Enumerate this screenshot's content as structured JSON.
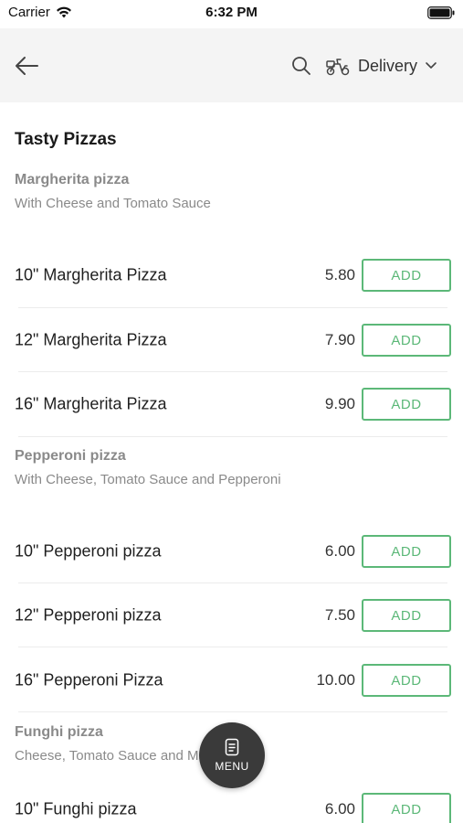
{
  "status_bar": {
    "carrier": "Carrier",
    "time": "6:32 PM"
  },
  "header": {
    "delivery_label": "Delivery"
  },
  "section": {
    "title": "Tasty Pizzas"
  },
  "groups": [
    {
      "name": "Margherita pizza",
      "description": "With Cheese and Tomato Sauce"
    },
    {
      "name": "Pepperoni pizza",
      "description": "With Cheese, Tomato Sauce and Pepperoni"
    },
    {
      "name": "Funghi pizza",
      "description": "Cheese, Tomato Sauce and M"
    }
  ],
  "items": [
    {
      "name": "10\" Margherita Pizza",
      "price": "5.80",
      "add_label": "ADD"
    },
    {
      "name": "12\" Margherita Pizza",
      "price": "7.90",
      "add_label": "ADD"
    },
    {
      "name": "16\" Margherita Pizza",
      "price": "9.90",
      "add_label": "ADD"
    },
    {
      "name": "10\" Pepperoni pizza",
      "price": "6.00",
      "add_label": "ADD"
    },
    {
      "name": "12\" Pepperoni pizza",
      "price": "7.50",
      "add_label": "ADD"
    },
    {
      "name": "16\" Pepperoni Pizza",
      "price": "10.00",
      "add_label": "ADD"
    },
    {
      "name": "10\" Funghi pizza",
      "price": "6.00",
      "add_label": "ADD"
    }
  ],
  "fab": {
    "label": "MENU"
  },
  "colors": {
    "accent_green": "#5cb878",
    "app_bar_bg": "#f4f4f4",
    "fab_bg": "#3a3a3a"
  },
  "icons": [
    "wifi-icon",
    "battery-icon",
    "back-arrow-icon",
    "search-icon",
    "delivery-scooter-icon",
    "chevron-down-icon",
    "menu-icon"
  ]
}
